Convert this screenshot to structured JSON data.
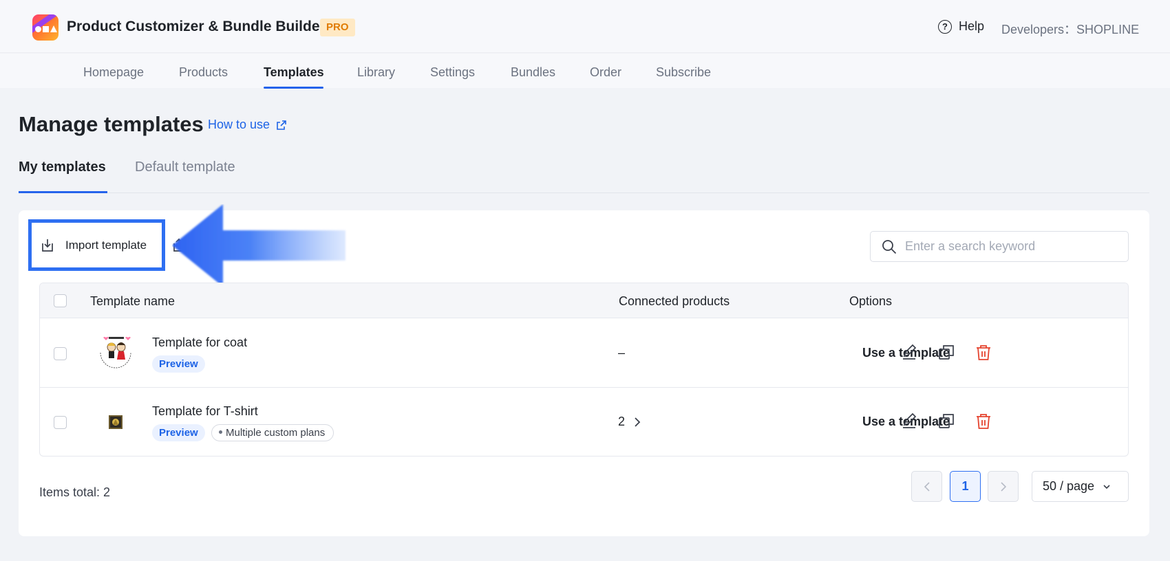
{
  "header": {
    "app_title": "Product Customizer & Bundle Builder",
    "pro_badge": "PRO",
    "help_label": "Help",
    "developers_label": "Developers：SHOPLINE"
  },
  "nav": {
    "items": [
      {
        "label": "Homepage"
      },
      {
        "label": "Products"
      },
      {
        "label": "Templates",
        "active": true
      },
      {
        "label": "Library"
      },
      {
        "label": "Settings"
      },
      {
        "label": "Bundles"
      },
      {
        "label": "Order"
      },
      {
        "label": "Subscribe"
      }
    ]
  },
  "page": {
    "title": "Manage templates",
    "how_to_use": "How to use"
  },
  "tabs": [
    {
      "label": "My templates",
      "active": true
    },
    {
      "label": "Default template",
      "active": false
    }
  ],
  "toolbar": {
    "import_label": "Import template",
    "search_placeholder": "Enter a search keyword"
  },
  "table": {
    "headers": {
      "name": "Template name",
      "connected": "Connected products",
      "options": "Options"
    },
    "rows": [
      {
        "name": "Template for coat",
        "preview": "Preview",
        "tag": "",
        "connected": "–",
        "action": "Use a template"
      },
      {
        "name": "Template for T-shirt",
        "preview": "Preview",
        "tag": "Multiple custom plans",
        "connected": "2",
        "action": "Use a template"
      }
    ]
  },
  "footer": {
    "items_total": "Items total: 2",
    "current_page": "1",
    "page_size": "50 / page"
  },
  "colors": {
    "accent": "#2563eb",
    "delete": "#e5432e",
    "pro_badge_bg": "#ffe9c4",
    "pro_badge_text": "#e07b00"
  },
  "icons": [
    "app-logo",
    "help-icon",
    "external-link-icon",
    "import-icon",
    "export-icon",
    "search-icon",
    "edit-icon",
    "copy-icon",
    "delete-icon",
    "chevron-right-icon",
    "chevron-left-icon",
    "chevron-down-icon"
  ]
}
